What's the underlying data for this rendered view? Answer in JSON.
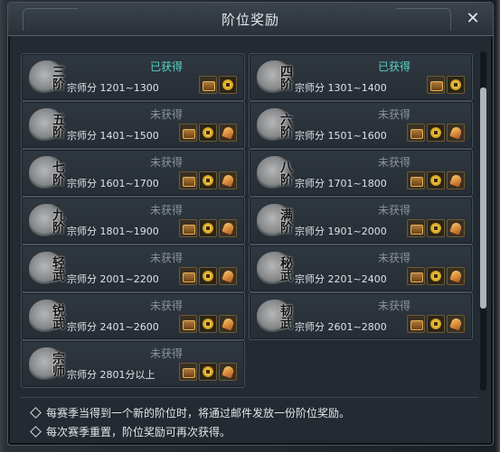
{
  "window": {
    "title": "阶位奖励",
    "close_label": "✕"
  },
  "ranks": [
    {
      "badge": "三阶",
      "status": "已获得",
      "obtained": true,
      "score": "宗师分 1201~1300",
      "rewards": [
        "chest-icon",
        "coin-icon"
      ]
    },
    {
      "badge": "四阶",
      "status": "已获得",
      "obtained": true,
      "score": "宗师分 1301~1400",
      "rewards": [
        "chest-icon",
        "coin-icon"
      ]
    },
    {
      "badge": "五阶",
      "status": "未获得",
      "obtained": false,
      "score": "宗师分 1401~1500",
      "rewards": [
        "chest-icon",
        "coin-icon",
        "bell-icon"
      ]
    },
    {
      "badge": "六阶",
      "status": "未获得",
      "obtained": false,
      "score": "宗师分 1501~1600",
      "rewards": [
        "chest-icon",
        "coin-icon",
        "bell-icon"
      ]
    },
    {
      "badge": "七阶",
      "status": "未获得",
      "obtained": false,
      "score": "宗师分 1601~1700",
      "rewards": [
        "chest-icon",
        "coin-icon",
        "bell-icon"
      ]
    },
    {
      "badge": "八阶",
      "status": "未获得",
      "obtained": false,
      "score": "宗师分 1701~1800",
      "rewards": [
        "chest-icon",
        "coin-icon",
        "bell-icon"
      ]
    },
    {
      "badge": "九阶",
      "status": "未获得",
      "obtained": false,
      "score": "宗师分 1801~1900",
      "rewards": [
        "chest-icon",
        "coin-icon",
        "bell-icon"
      ]
    },
    {
      "badge": "满阶",
      "status": "未获得",
      "obtained": false,
      "score": "宗师分 1901~2000",
      "rewards": [
        "chest-icon",
        "coin-icon",
        "bell-icon"
      ]
    },
    {
      "badge": "轻武",
      "status": "未获得",
      "obtained": false,
      "score": "宗师分 2001~2200",
      "rewards": [
        "chest-icon",
        "coin-icon",
        "bell-icon"
      ]
    },
    {
      "badge": "秘武",
      "status": "未获得",
      "obtained": false,
      "score": "宗师分 2201~2400",
      "rewards": [
        "chest-icon",
        "coin-icon",
        "bell-icon"
      ]
    },
    {
      "badge": "锐武",
      "status": "未获得",
      "obtained": false,
      "score": "宗师分 2401~2600",
      "rewards": [
        "chest-icon",
        "coin-icon",
        "bell-icon"
      ]
    },
    {
      "badge": "韧武",
      "status": "未获得",
      "obtained": false,
      "score": "宗师分 2601~2800",
      "rewards": [
        "chest-icon",
        "coin-icon",
        "bell-icon"
      ]
    },
    {
      "badge": "宗师",
      "status": "未获得",
      "obtained": false,
      "score": "宗师分 2801分以上",
      "rewards": [
        "chest-icon",
        "coin-icon",
        "bell-icon"
      ]
    }
  ],
  "notes": [
    "每赛季当得到一个新的阶位时，将通过邮件发放一份阶位奖励。",
    "每次赛季重置，阶位奖励可再次获得。"
  ],
  "colors": {
    "obtained": "#56d3c6",
    "not_obtained": "#8b939b"
  }
}
